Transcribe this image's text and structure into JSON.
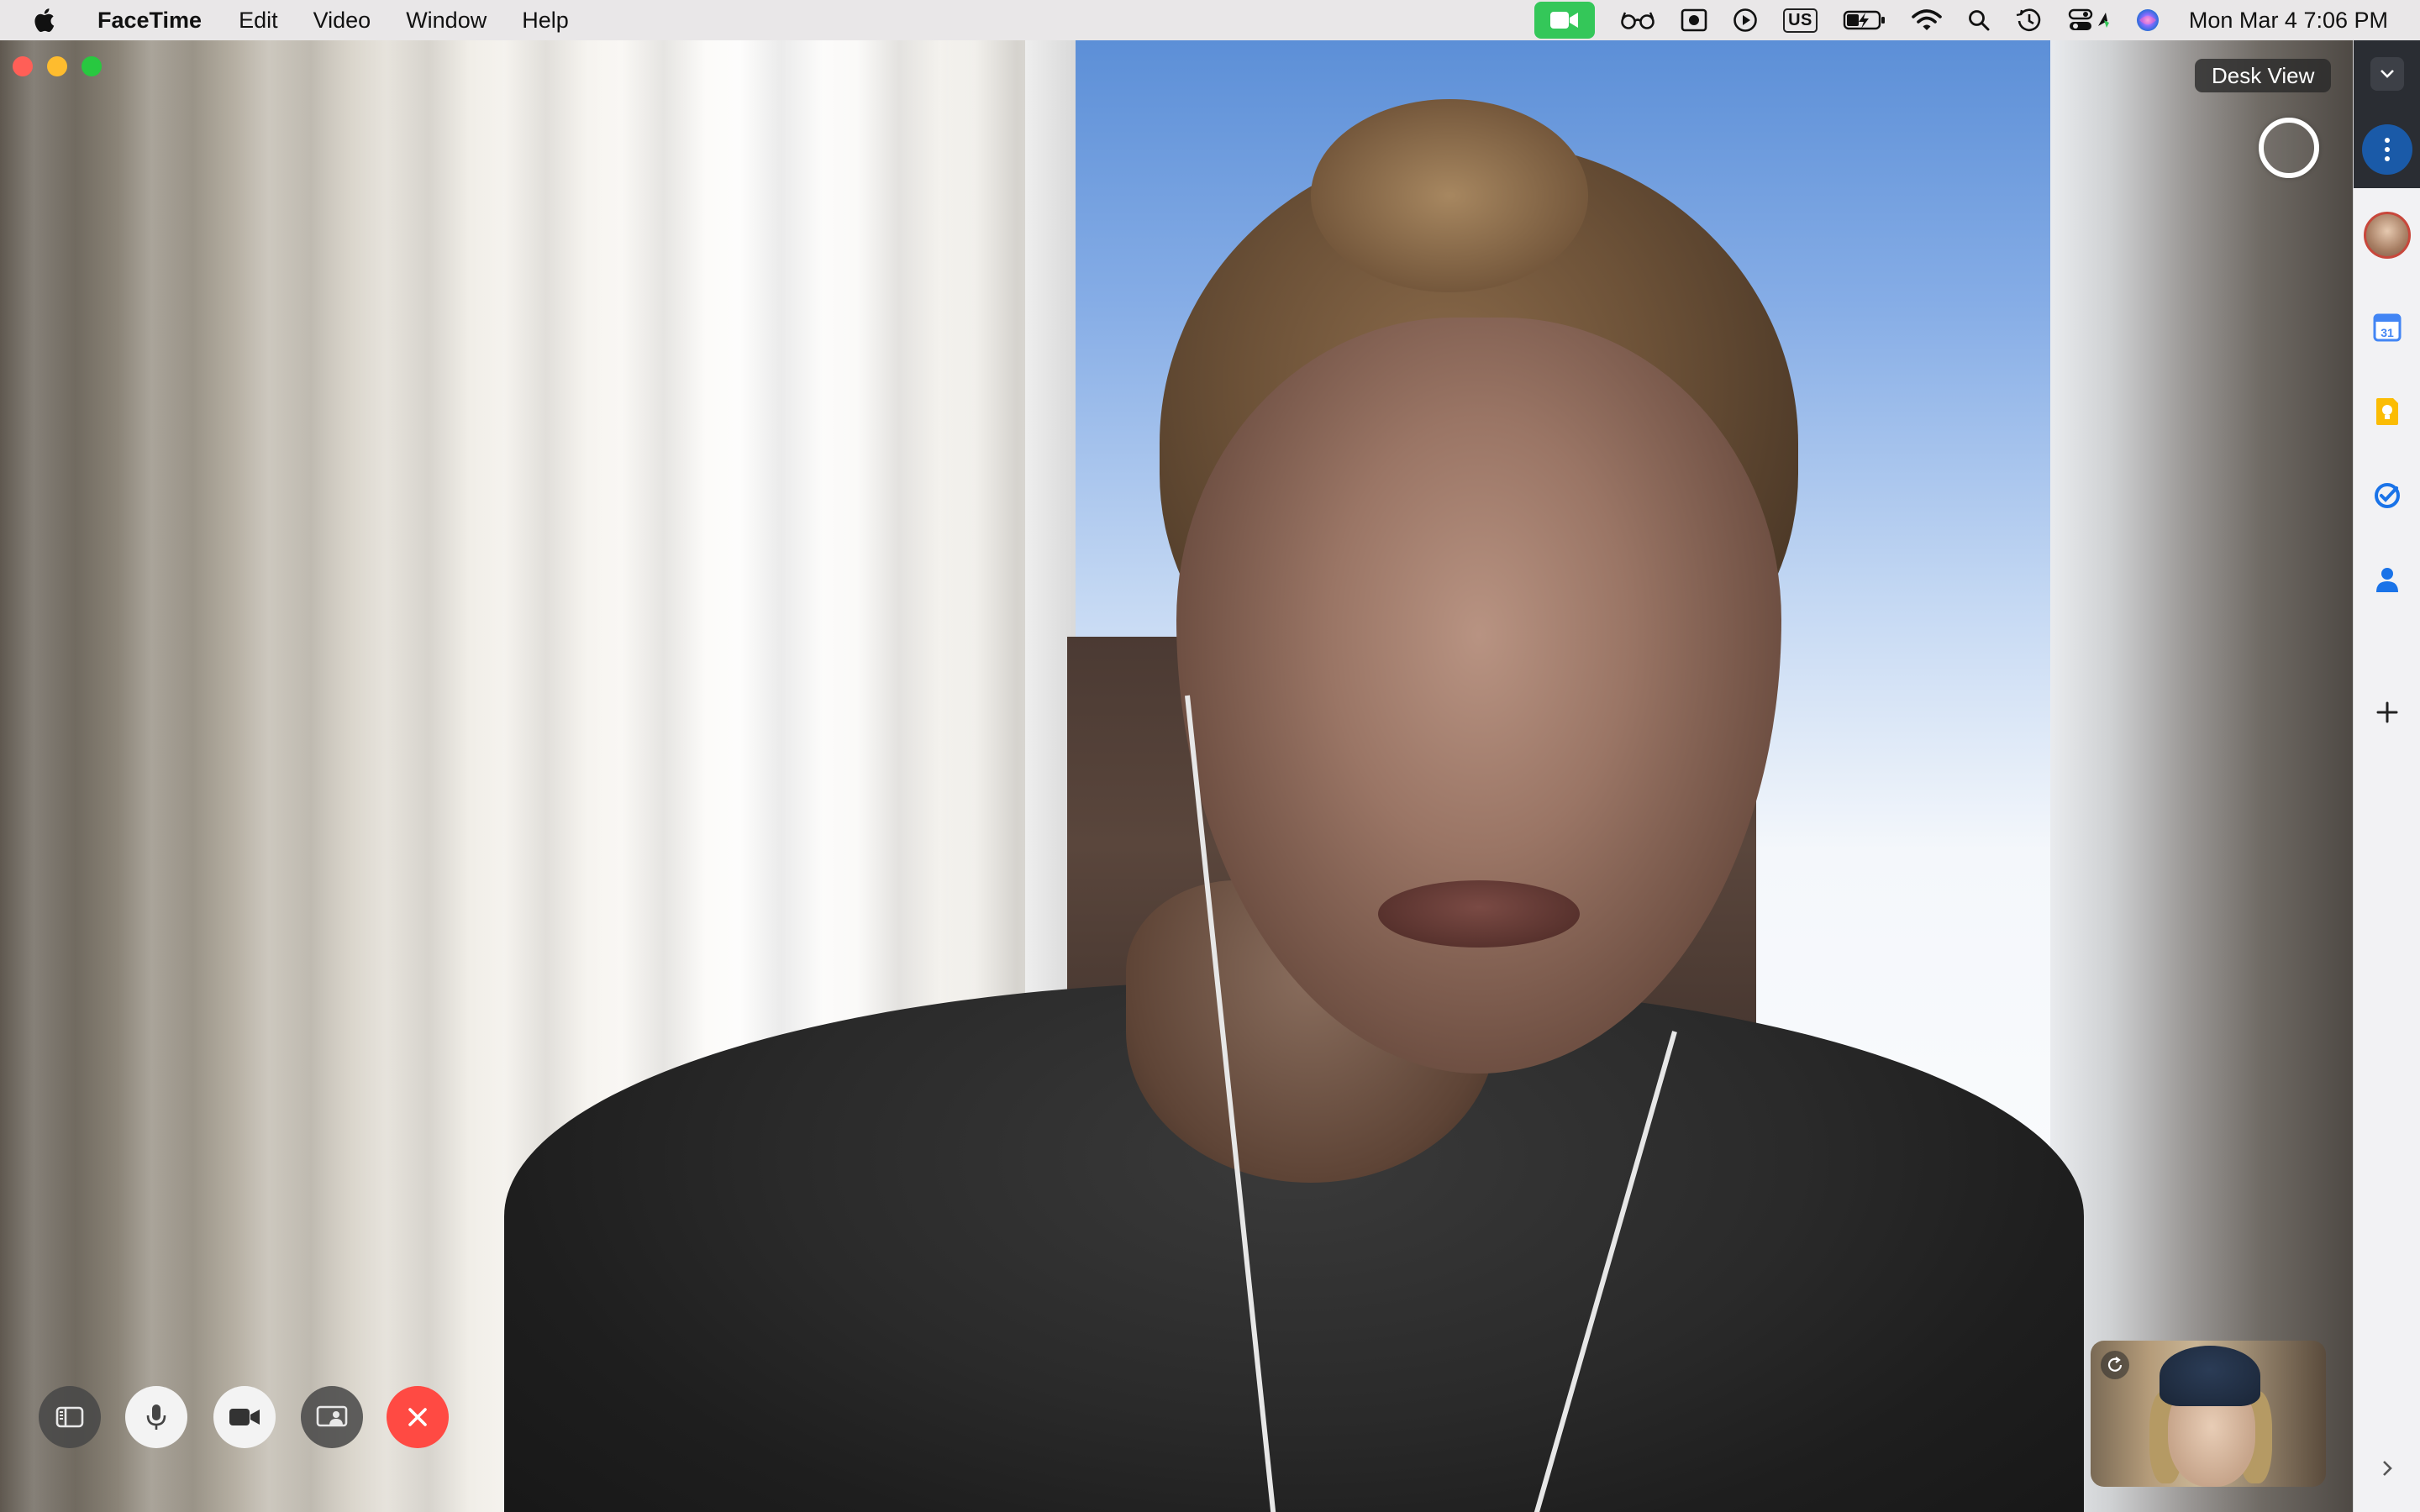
{
  "menubar": {
    "app_name": "FaceTime",
    "menus": [
      "Edit",
      "Video",
      "Window",
      "Help"
    ],
    "status_icons": [
      "facetime-camera-icon",
      "reader-glasses-icon",
      "screen-record-icon",
      "play-icon",
      "input-source-icon",
      "battery-charging-icon",
      "wifi-icon",
      "spotlight-search-icon",
      "time-machine-icon",
      "control-center-icon",
      "siri-icon"
    ],
    "input_source": "US",
    "clock": "Mon Mar 4  7:06 PM"
  },
  "call": {
    "desk_view_label": "Desk View",
    "controls": [
      "sidebar-toggle",
      "mute-microphone",
      "camera-toggle",
      "share-screen",
      "end-call"
    ]
  },
  "side_panel": {
    "apps": [
      "contact-avatar",
      "google-calendar-icon",
      "google-keep-icon",
      "google-tasks-icon",
      "google-contacts-icon"
    ],
    "calendar_day": "31"
  },
  "colors": {
    "menubar_bg": "#e9e7e8",
    "facetime_green": "#34c759",
    "end_call_red": "#ff4a43",
    "traffic_close": "#ff5f57",
    "traffic_min": "#febc2e",
    "traffic_max": "#28c840"
  }
}
